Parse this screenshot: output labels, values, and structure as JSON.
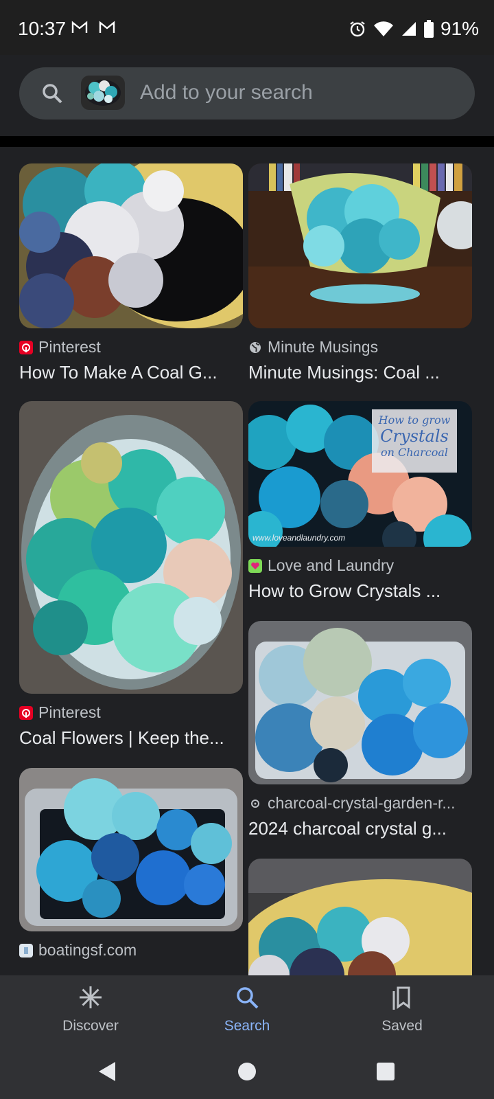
{
  "status": {
    "time": "10:37",
    "battery": "91%"
  },
  "search": {
    "placeholder": "Add to your search"
  },
  "results": [
    {
      "source": "Pinterest",
      "title": "How To Make A Coal G...",
      "favicon": "pinterest-icon"
    },
    {
      "source": "Minute Musings",
      "title": "Minute Musings: Coal ...",
      "favicon": "globe-icon"
    },
    {
      "source": "Pinterest",
      "title": "Coal Flowers | Keep the...",
      "favicon": "pinterest-icon"
    },
    {
      "source": "Love and Laundry",
      "title": "How to Grow Crystals ...",
      "favicon": "heart-icon",
      "overlay": [
        "How to grow",
        "Crystals",
        "on Charcoal"
      ],
      "watermark": "www.loveandlaundry.com"
    },
    {
      "source": "charcoal-crystal-garden-r...",
      "title": "2024 charcoal crystal g...",
      "favicon": "link-icon"
    },
    {
      "source": "boatingsf.com",
      "title": "",
      "favicon": "site-icon"
    },
    {
      "source": "",
      "title": "",
      "favicon": ""
    }
  ],
  "nav": {
    "discover": "Discover",
    "search": "Search",
    "saved": "Saved"
  },
  "colors": {
    "accent": "#8ab4f8",
    "pinterest": "#e60023",
    "background": "#202124"
  }
}
